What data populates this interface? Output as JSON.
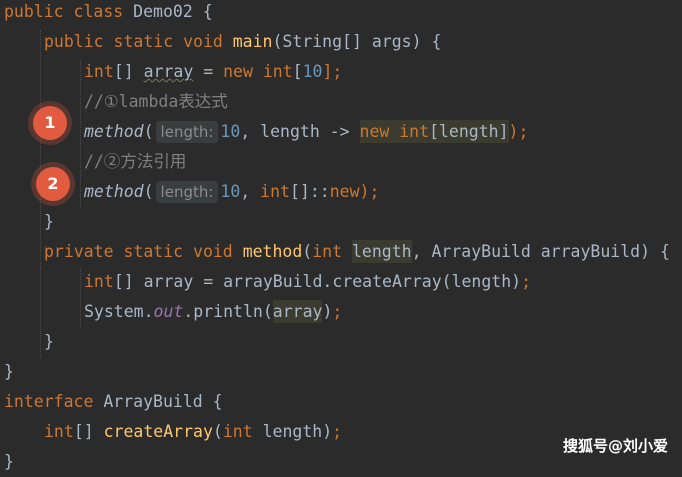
{
  "code": {
    "l1_kw": "public class",
    "l1_rest": " Demo02 {",
    "l2_kw1": "public static void",
    "l2_fn": "main",
    "l2_rest": "(String[] args) {",
    "l3_type": "int",
    "l3_br": "[] ",
    "l3_var": "array",
    "l3_eq": " = ",
    "l3_new": "new int",
    "l3_open": "[",
    "l3_num": "10",
    "l3_close": "];",
    "l4_comment": "//①lambda表达式",
    "l5_method": "method",
    "l5_open": "(",
    "l5_hint": "length:",
    "l5_num": "10",
    "l5_mid": ", length -> ",
    "l5_new": "new int",
    "l5_hl_rest": "[length]",
    "l5_close": ");",
    "l6_comment": "//②方法引用",
    "l7_method": "method",
    "l7_open": "(",
    "l7_hint": "length:",
    "l7_num": "10",
    "l7_mid": ", ",
    "l7_int": "int",
    "l7_ref": "[]::",
    "l7_new": "new",
    "l7_close": ");",
    "l8": "}",
    "l9_kw": "private static void",
    "l9_fn": "method",
    "l9_open": "(",
    "l9_int": "int",
    "l9_param": "length",
    "l9_rest": ", ArrayBuild arrayBuild) {",
    "l10_int": "int",
    "l10_rest": "[] array = arrayBuild.createArray(length)",
    "l10_semi": ";",
    "l11_a": "System.",
    "l11_out": "out",
    "l11_b": ".println(",
    "l11_arr": "array",
    "l11_close": ")",
    "l11_semi": ";",
    "l12": "}",
    "l13": "}",
    "l14_kw": "interface",
    "l14_rest": " ArrayBuild {",
    "l15_int": "int",
    "l15_br": "[] ",
    "l15_fn": "createArray",
    "l15_open": "(",
    "l15_int2": "int",
    "l15_rest": " length)",
    "l15_semi": ";",
    "l16": "}"
  },
  "badges": {
    "first": "1",
    "second": "2"
  },
  "watermark": "搜狐号@刘小爱",
  "colors": {
    "background": "#2b2b2b",
    "keyword": "#cc7832",
    "function": "#ffc66d",
    "number": "#6897bb",
    "comment": "#808080",
    "field": "#9876aa",
    "text": "#a9b7c6",
    "badge": "#e25a40"
  }
}
